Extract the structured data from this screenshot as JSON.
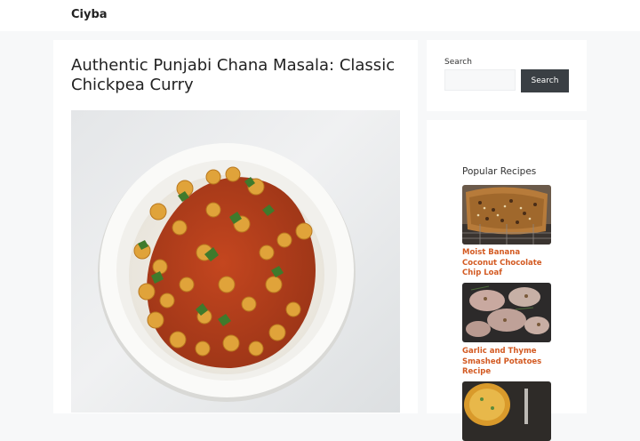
{
  "header": {
    "site_title": "Ciyba"
  },
  "post": {
    "title": "Authentic Punjabi Chana Masala: Classic Chickpea Curry",
    "hero_image": "chana-masala-bowl-photo"
  },
  "sidebar": {
    "search": {
      "label": "Search",
      "placeholder": "",
      "value": "",
      "button_label": "Search"
    },
    "popular": {
      "heading": "Popular Recipes",
      "items": [
        {
          "title": "Moist Banana Coconut Chocolate Chip Loaf",
          "image": "banana-loaf-photo"
        },
        {
          "title": "Garlic and Thyme Smashed Potatoes Recipe",
          "image": "smashed-potatoes-photo"
        },
        {
          "title": "",
          "image": "casserole-photo"
        }
      ]
    }
  },
  "colors": {
    "page_background": "#f7f8f9",
    "link_accent": "#d35a22",
    "search_button": "#3a3f44"
  }
}
